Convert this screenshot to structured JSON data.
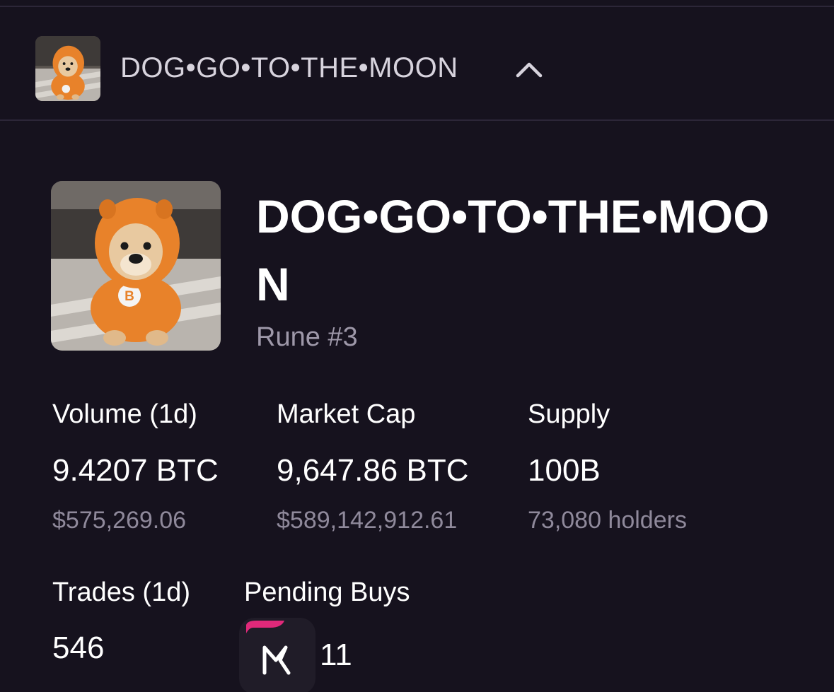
{
  "header": {
    "collapsed_name": "DOG•GO•TO•THE•MOON",
    "toggle_icon": "chevron-up-icon"
  },
  "rune": {
    "title": "DOG•GO•TO•THE•MOON",
    "number_label": "Rune #3",
    "image_icon": "dog-in-orange-hoodie-image"
  },
  "stats": {
    "volume": {
      "label": "Volume (1d)",
      "value": "9.4207 BTC",
      "sub": "$575,269.06"
    },
    "market_cap": {
      "label": "Market Cap",
      "value": "9,647.86 BTC",
      "sub": "$589,142,912.61"
    },
    "supply": {
      "label": "Supply",
      "value": "100B",
      "sub": "73,080 holders"
    },
    "trades": {
      "label": "Trades (1d)",
      "value": "546"
    },
    "pending_buys": {
      "label": "Pending Buys",
      "value": "11",
      "logo_icon": "magic-eden-logo-icon"
    }
  },
  "colors": {
    "background": "#16121e",
    "divider": "#2c2638",
    "muted_text": "#8f899b",
    "hoodie_orange": "#e8822a",
    "logo_accent": "#e0297a"
  }
}
